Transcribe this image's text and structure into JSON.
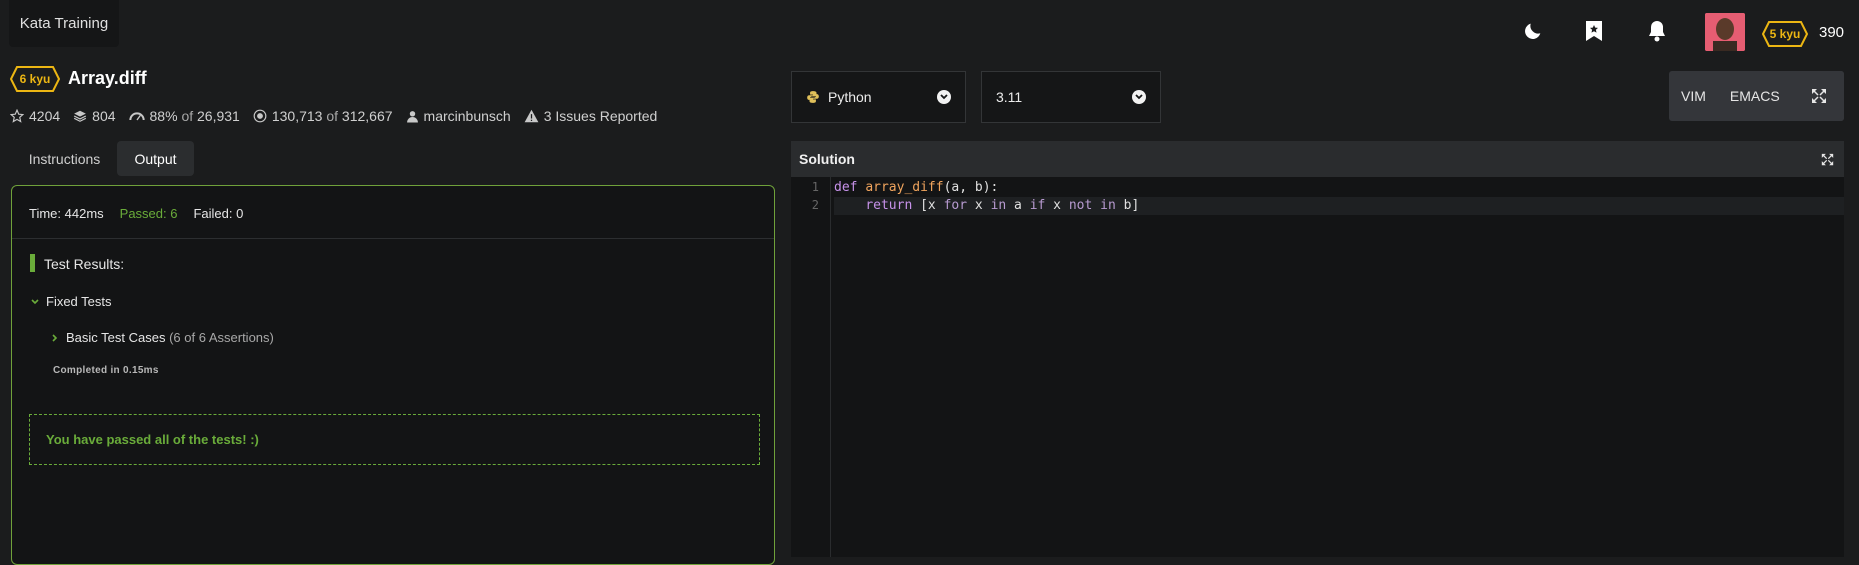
{
  "topbar": {
    "brand": "Kata Training",
    "user_rank": "5 kyu",
    "honor": "390"
  },
  "kata": {
    "rank": "6 kyu",
    "title": "Array.diff",
    "stats": {
      "stars": "4204",
      "collections": "804",
      "satisfaction_pct": "88%",
      "satisfaction_of": "of",
      "satisfaction_total": "26,931",
      "completed": "130,713",
      "completed_of": "of",
      "attempts": "312,667",
      "author": "marcinbunsch",
      "issues": "3 Issues Reported"
    }
  },
  "tabs": {
    "instructions": "Instructions",
    "output": "Output"
  },
  "output": {
    "time": "Time: 442ms",
    "passed": "Passed: 6",
    "failed": "Failed: 0",
    "results_title": "Test Results:",
    "fixed_tests": "Fixed Tests",
    "basic_tests": "Basic Test Cases",
    "assertions": "(6 of 6 Assertions)",
    "completed": "Completed in 0.15ms",
    "success_message": "You have passed all of the tests! :)"
  },
  "editor": {
    "language": "Python",
    "version": "3.11",
    "mode_vim": "VIM",
    "mode_emacs": "EMACS",
    "solution_title": "Solution",
    "line_numbers": [
      "1",
      "2"
    ],
    "code": {
      "l1_def": "def",
      "l1_fn": "array_diff",
      "l1_rest": "(a, b):",
      "l2_indent": "    ",
      "l2_return": "return",
      "l2_a": " [x ",
      "l2_for": "for",
      "l2_b": " x ",
      "l2_in": "in",
      "l2_c": " a ",
      "l2_if": "if",
      "l2_d": " x ",
      "l2_not": "not",
      "l2_e": " ",
      "l2_in2": "in",
      "l2_f": " b]"
    }
  },
  "colors": {
    "accent_green": "#6aac3a",
    "rank_yellow": "#ecb613",
    "background": "#1b1c1d"
  }
}
